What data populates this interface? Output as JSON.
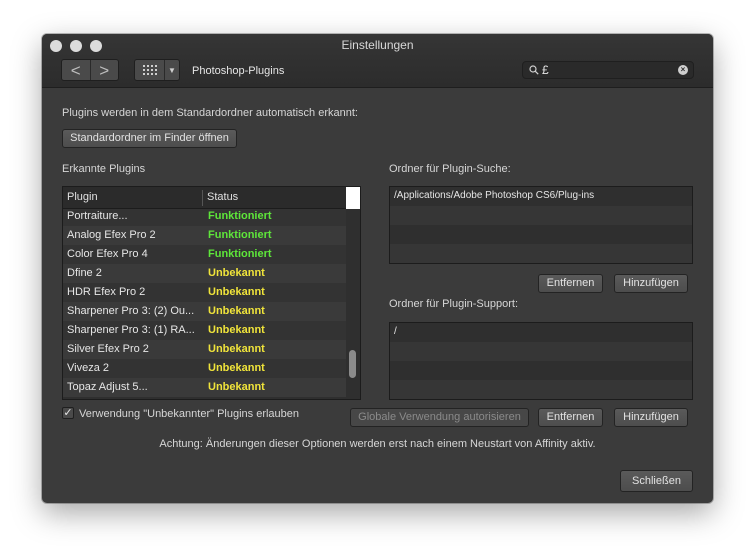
{
  "window": {
    "title": "Einstellungen"
  },
  "toolbar": {
    "back": "<",
    "forward": ">",
    "pane_title": "Photoshop-Plugins",
    "search_value": "£"
  },
  "auto_detect_text": "Plugins werden in dem Standardordner automatisch erkannt:",
  "open_default_folder_button": "Standardordner im Finder öffnen",
  "detected_plugins": {
    "label": "Erkannte Plugins",
    "columns": [
      "Plugin",
      "Status"
    ],
    "rows": [
      {
        "name": "Portraiture...",
        "status": "Funktioniert",
        "ok": true
      },
      {
        "name": "Analog Efex Pro 2",
        "status": "Funktioniert",
        "ok": true
      },
      {
        "name": "Color Efex Pro 4",
        "status": "Funktioniert",
        "ok": true
      },
      {
        "name": "Dfine 2",
        "status": "Unbekannt",
        "ok": false
      },
      {
        "name": "HDR Efex Pro 2",
        "status": "Unbekannt",
        "ok": false
      },
      {
        "name": "Sharpener Pro 3: (2) Ou...",
        "status": "Unbekannt",
        "ok": false
      },
      {
        "name": "Sharpener Pro 3: (1) RA...",
        "status": "Unbekannt",
        "ok": false
      },
      {
        "name": "Silver Efex Pro 2",
        "status": "Unbekannt",
        "ok": false
      },
      {
        "name": "Viveza 2",
        "status": "Unbekannt",
        "ok": false
      },
      {
        "name": "Topaz Adjust 5...",
        "status": "Unbekannt",
        "ok": false
      }
    ]
  },
  "search_folders": {
    "label": "Ordner für Plugin-Suche:",
    "items": [
      "/Applications/Adobe Photoshop CS6/Plug-ins",
      "",
      "",
      ""
    ],
    "remove_button": "Entfernen",
    "add_button": "Hinzufügen"
  },
  "support_folders": {
    "label": "Ordner für Plugin-Support:",
    "items": [
      "/",
      "",
      "",
      ""
    ],
    "remove_button": "Entfernen",
    "add_button": "Hinzufügen"
  },
  "allow_unknown": {
    "label": "Verwendung \"Unbekannter\" Plugins erlauben",
    "checked": true,
    "mark": "✓"
  },
  "authorize_global_button": "Globale Verwendung autorisieren",
  "warning_text": "Achtung: Änderungen dieser Optionen werden erst nach einem Neustart von Affinity aktiv.",
  "close_button": "Schließen",
  "colors": {
    "status_ok": "#5ee63a",
    "status_unknown": "#f0e43a"
  }
}
